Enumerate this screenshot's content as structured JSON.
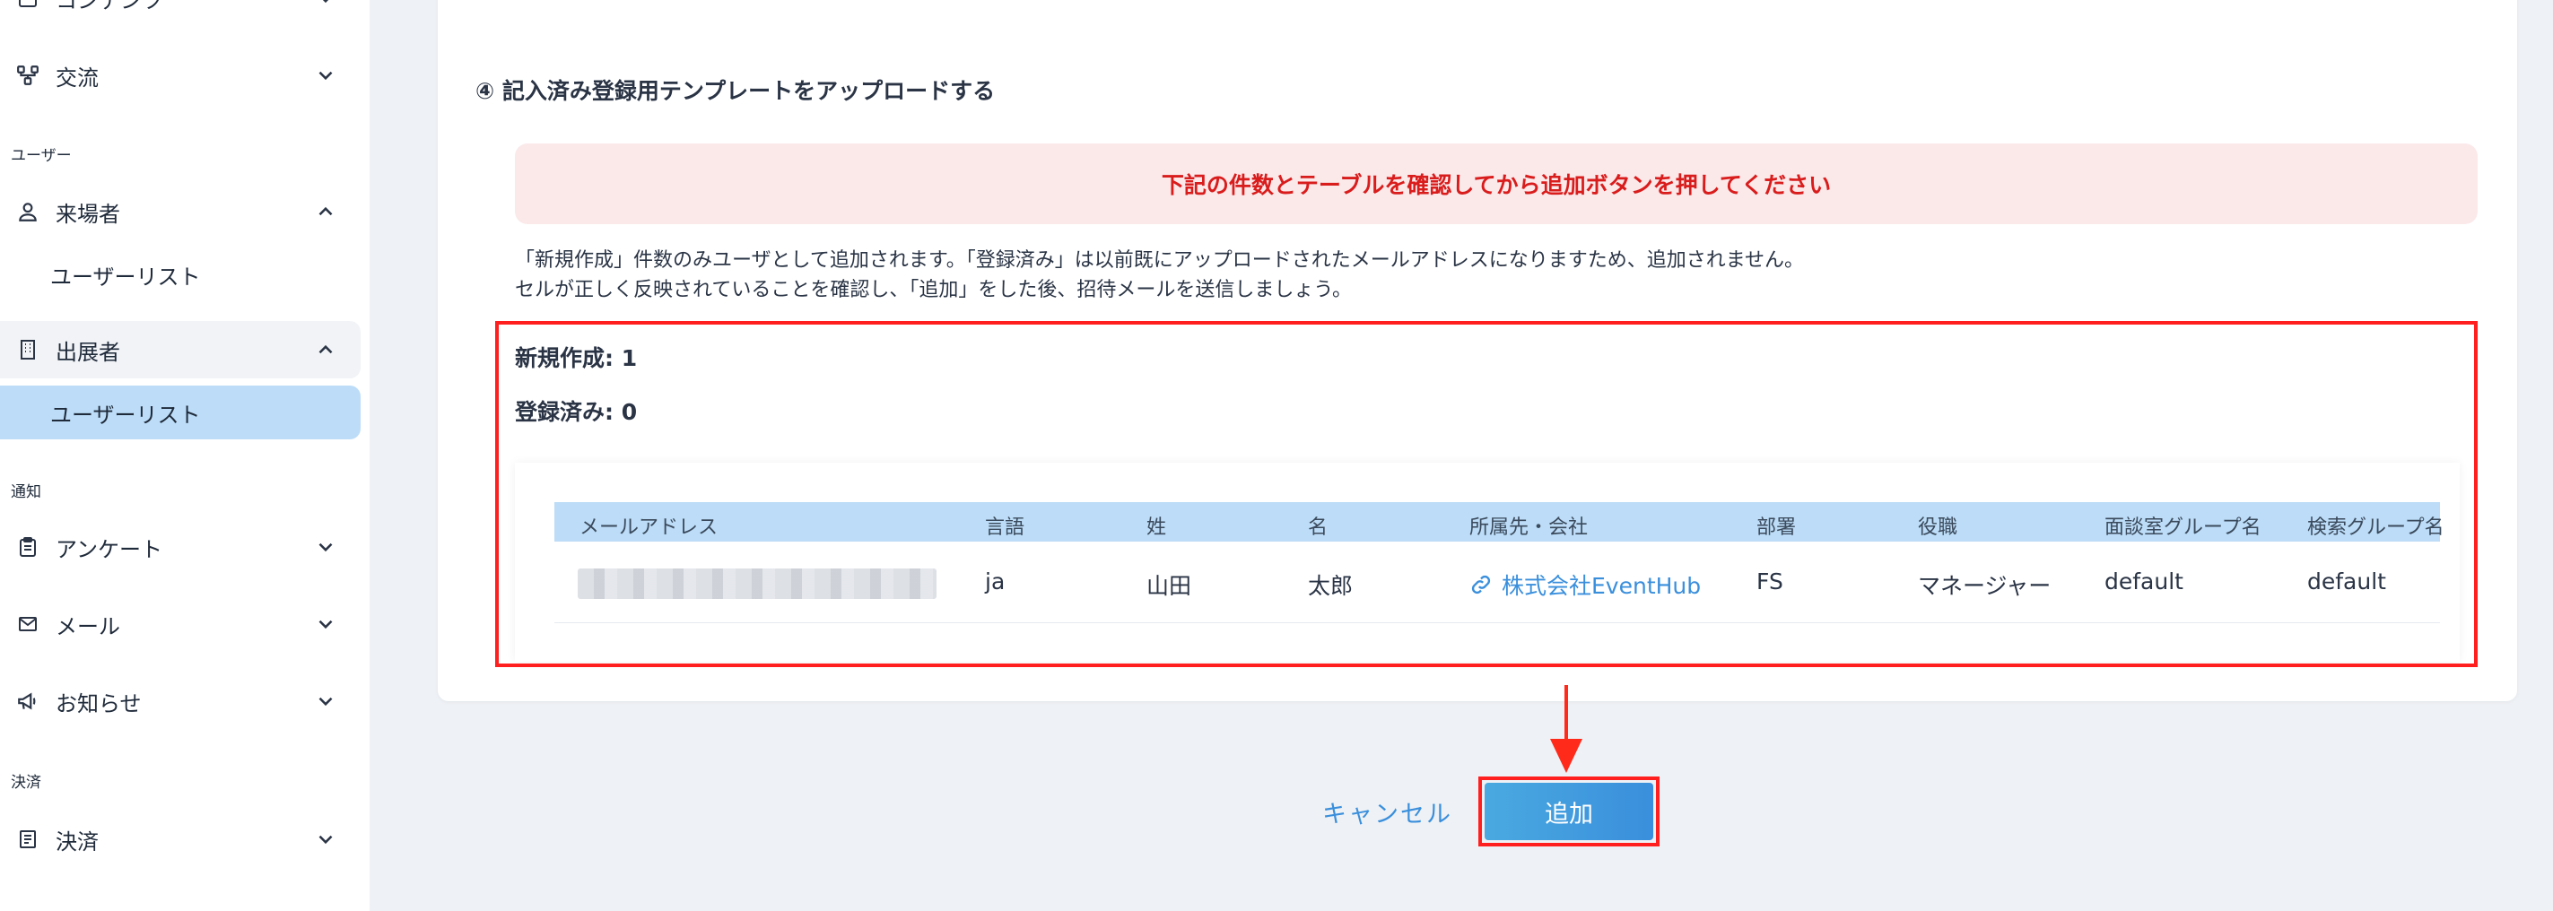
{
  "sidebar": {
    "top_partial_label": "コンテンツ",
    "items": [
      {
        "label": "交流",
        "icon": "network-icon"
      },
      {
        "section": "ユーザー"
      },
      {
        "label": "来場者",
        "icon": "person-icon",
        "expanded": true
      },
      {
        "sub": "ユーザーリスト"
      },
      {
        "label": "出展者",
        "icon": "building-icon",
        "expanded": true
      },
      {
        "sub": "ユーザーリスト",
        "active": true
      },
      {
        "section": "通知"
      },
      {
        "label": "アンケート",
        "icon": "clipboard-icon"
      },
      {
        "label": "メール",
        "icon": "mail-icon"
      },
      {
        "label": "お知らせ",
        "icon": "megaphone-icon"
      },
      {
        "section": "決済"
      },
      {
        "label": "決済",
        "icon": "receipt-icon"
      }
    ]
  },
  "main": {
    "step_title": "④ 記入済み登録用テンプレートをアップロードする",
    "alert": "下記の件数とテーブルを確認してから追加ボタンを押してください",
    "description": [
      "「新規作成」件数のみユーザとして追加されます。「登録済み」は以前既にアップロードされたメールアドレスになりますため、追加されません。",
      "セルが正しく反映されていることを確認し、「追加」をした後、招待メールを送信しましょう。"
    ],
    "stats": {
      "new_label": "新規作成: 1",
      "registered_label": "登録済み: 0"
    },
    "table": {
      "headers": [
        "メールアドレス",
        "言語",
        "姓",
        "名",
        "所属先・会社",
        "部署",
        "役職",
        "面談室グループ名",
        "検索グループ名"
      ],
      "rows": [
        [
          "",
          "ja",
          "山田",
          "太郎",
          "株式会社EventHub",
          "FS",
          "マネージャー",
          "default",
          "default"
        ]
      ]
    },
    "actions": {
      "cancel": "キャンセル",
      "add": "追加"
    }
  },
  "colors": {
    "accent": "#3a8fdc",
    "highlight": "#ff1f1f",
    "alert_text": "#d91c1c",
    "alert_bg": "#fbe9ea",
    "table_header": "#bcdcf7"
  }
}
